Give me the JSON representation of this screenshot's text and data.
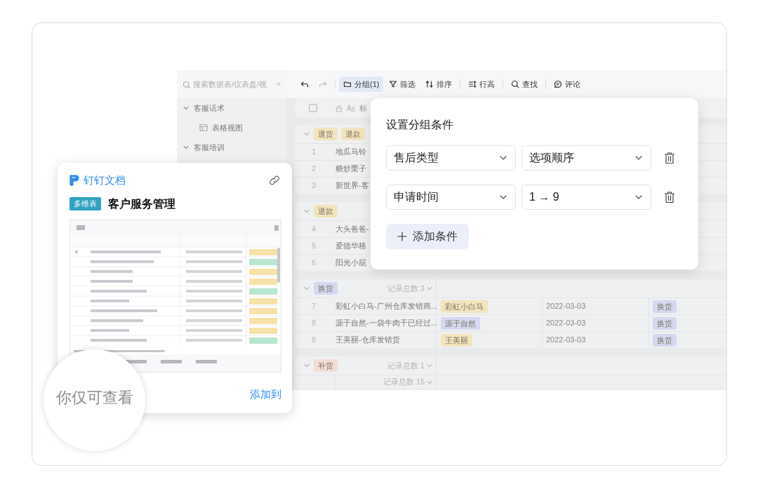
{
  "sidebar": {
    "search": {
      "placeholder": "搜索数据表/仪表盘/视"
    },
    "items": [
      {
        "label": "客服话术",
        "expanded": true,
        "children": [
          {
            "label": "表格视图"
          }
        ]
      },
      {
        "label": "客服培训",
        "expanded": true
      }
    ]
  },
  "toolbar": [
    {
      "kind": "undo",
      "disabled": false
    },
    {
      "kind": "redo",
      "disabled": true
    },
    {
      "kind": "group",
      "label": "分组(1)",
      "selected": true
    },
    {
      "kind": "filter",
      "label": "筛选",
      "selected": false
    },
    {
      "kind": "sort",
      "label": "排序",
      "selected": false
    },
    {
      "kind": "row-height",
      "label": "行高",
      "selected": false
    },
    {
      "kind": "find",
      "label": "查找",
      "selected": false
    },
    {
      "kind": "comment",
      "label": "评论",
      "selected": false
    }
  ],
  "table": {
    "header": {
      "checked": false,
      "column_1": "标"
    },
    "groups": [
      {
        "tags": [
          {
            "label": "退货",
            "color": "#f2e4bd"
          },
          {
            "label": "退款",
            "color": "#f2e4bd"
          }
        ],
        "rows": [
          {
            "number": "1",
            "title": "地瓜马铃"
          },
          {
            "number": "2",
            "title": "糖炒栗子"
          },
          {
            "number": "3",
            "title": "新世界-客"
          }
        ]
      },
      {
        "tags": [
          {
            "label": "退款",
            "color": "#f2e4bd"
          }
        ],
        "rows": [
          {
            "number": "4",
            "title": "大头爸爸-"
          },
          {
            "number": "5",
            "title": "爱德华格"
          },
          {
            "number": "6",
            "title": "阳光小屁"
          }
        ]
      },
      {
        "tags": [
          {
            "label": "换货",
            "color": "#d5d8f0"
          }
        ],
        "count": "记录总数 3",
        "rows": [
          {
            "number": "7",
            "title": "彩虹小白马-广州仓库发错商...",
            "name": {
              "label": "彩虹小白马",
              "color": "#f2e4bd"
            },
            "date": "2022-03-03",
            "type": {
              "label": "换货",
              "color": "#d5d8f0"
            }
          },
          {
            "number": "8",
            "title": "源于自然-一袋牛肉干已经过...",
            "name": {
              "label": "源于自然",
              "color": "#d5d8f0"
            },
            "date": "2022-03-03",
            "type": {
              "label": "换货",
              "color": "#d5d8f0"
            }
          },
          {
            "number": "9",
            "title": "王美丽-仓库发错货",
            "name": {
              "label": "王美丽",
              "color": "#f2e4bd"
            },
            "date": "2022-03-03",
            "type": {
              "label": "换货",
              "color": "#d5d8f0"
            }
          }
        ]
      },
      {
        "tags": [
          {
            "label": "补货",
            "color": "#f3ddd6"
          }
        ],
        "count": "记录总数 1"
      }
    ],
    "footer": "记录总数 15"
  },
  "group_popup": {
    "title": "设置分组条件",
    "conditions": [
      {
        "field": "售后类型",
        "order": "选项顺序"
      },
      {
        "field": "申请时间",
        "order": "1 → 9"
      }
    ],
    "add_button": "添加条件"
  },
  "share_card": {
    "brand": "钉钉文档",
    "badge": "多维表",
    "title": "客户服务管理",
    "action": "添加到"
  },
  "magnifier": {
    "text": "你仅可查看"
  }
}
